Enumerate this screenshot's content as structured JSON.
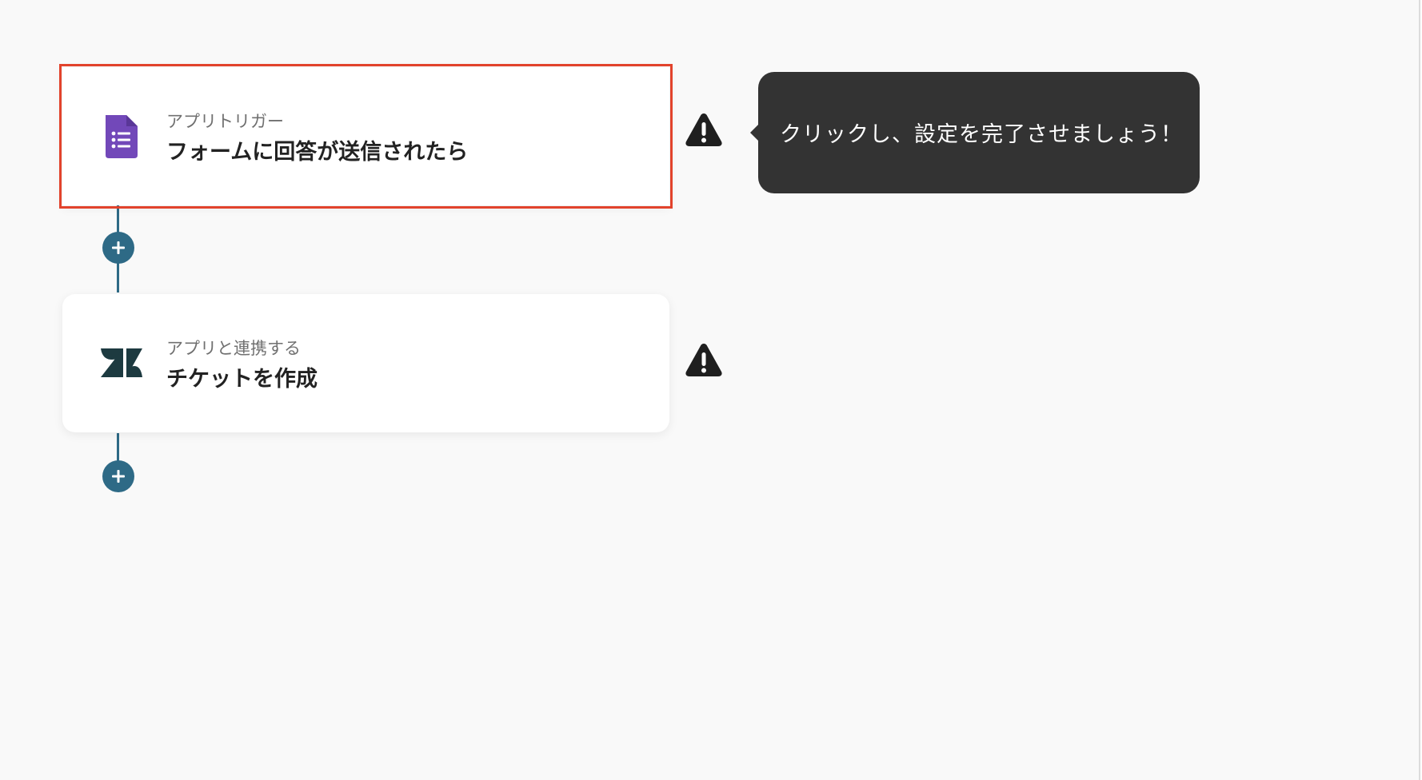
{
  "flow": {
    "steps": [
      {
        "subtitle": "アプリトリガー",
        "title": "フォームに回答が送信されたら",
        "icon": "google-forms-icon",
        "icon_color": "#7248b9",
        "status": "warning"
      },
      {
        "subtitle": "アプリと連携する",
        "title": "チケットを作成",
        "icon": "zendesk-icon",
        "icon_color": "#1d3a40",
        "status": "warning"
      }
    ],
    "add_buttons": [
      {
        "icon": "plus-icon"
      },
      {
        "icon": "plus-icon"
      }
    ]
  },
  "tooltip": {
    "text": "クリックし、設定を完了させましょう！"
  },
  "colors": {
    "background": "#f9f9f9",
    "connector": "#2e6a86",
    "highlight": "#e2432c",
    "tooltip_bg": "#333333",
    "warning": "#1f1f1f"
  }
}
